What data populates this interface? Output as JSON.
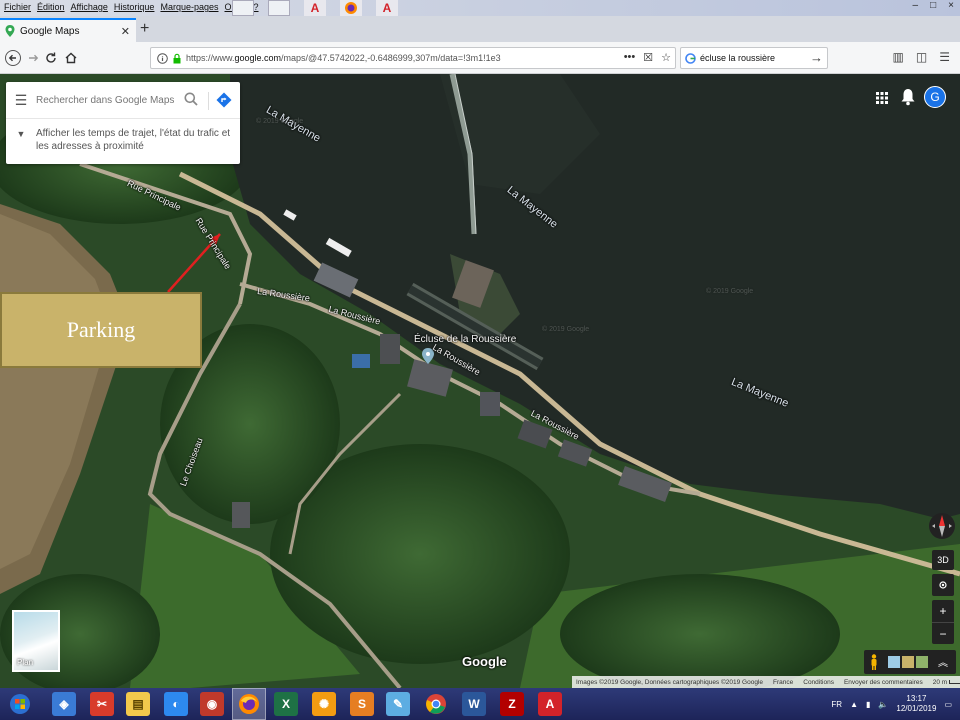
{
  "browser": {
    "menu": [
      "Fichier",
      "Édition",
      "Affichage",
      "Historique",
      "Marque-pages",
      "Outils",
      "?"
    ],
    "tab_title": "Google Maps",
    "url_prefix": "https://www.",
    "url_domain": "google.com",
    "url_rest": "/maps/@47.5742022,-0.6486999,307m/data=!3m1!1e3",
    "search_value": "écluse la roussière",
    "win_controls": [
      "–",
      "□",
      "×"
    ]
  },
  "maps": {
    "search_placeholder": "Rechercher dans Google Maps",
    "hint_text": "Afficher les temps de trajet, l'état du trafic et les adresses à proximité",
    "avatar_letter": "G",
    "plan_label": "Plan",
    "google_logo": "Google",
    "btn_3d": "3D",
    "zoom_in": "+",
    "zoom_out": "−",
    "place_label": "Écluse de la Roussière",
    "parking_label": "Parking",
    "water_labels": [
      "La Mayenne",
      "La Mayenne",
      "La Mayenne"
    ],
    "road_labels": [
      "Rue Principale",
      "Rue Principale",
      "La Roussière",
      "La Roussière",
      "La Roussière",
      "La Roussière",
      "Le Choiseau"
    ],
    "watermarks": [
      "© 2019 Google",
      "© 2019 Google",
      "© 2019 Google"
    ],
    "attribution": {
      "images": "Images ©2019 Google, Données cartographiques ©2019 Google",
      "country": "France",
      "terms": "Conditions",
      "feedback": "Envoyer des commentaires",
      "scale": "20 m"
    }
  },
  "taskbar": {
    "lang": "FR",
    "time": "13:17",
    "date": "12/01/2019"
  },
  "colors": {
    "accent_blue": "#1a73e8",
    "firefox_tab_blue": "#0a84ff",
    "parking_gold": "#c9b36a",
    "marker_red": "#e02020",
    "river": "#222a26"
  }
}
